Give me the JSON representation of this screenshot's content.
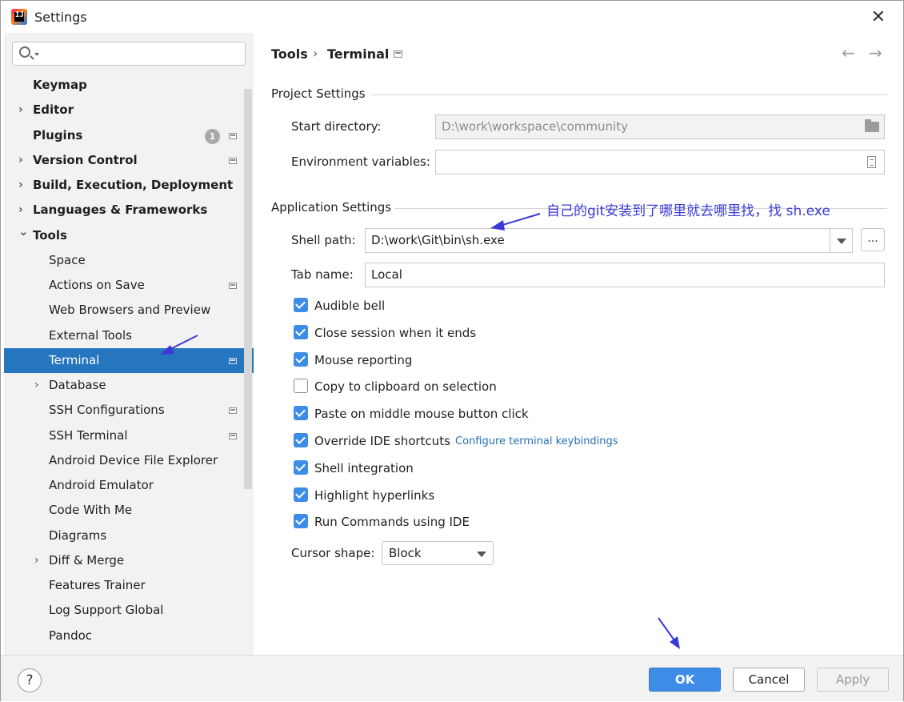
{
  "window": {
    "title": "Settings"
  },
  "sidebar": {
    "search_placeholder": "",
    "items": [
      {
        "label": "Keymap",
        "bold": true,
        "expandable": false,
        "indent": 0
      },
      {
        "label": "Editor",
        "bold": true,
        "expandable": true,
        "indent": 0
      },
      {
        "label": "Plugins",
        "bold": true,
        "expandable": false,
        "indent": 0,
        "badge": "1",
        "project": true
      },
      {
        "label": "Version Control",
        "bold": true,
        "expandable": true,
        "indent": 0,
        "project": true
      },
      {
        "label": "Build, Execution, Deployment",
        "bold": true,
        "expandable": true,
        "indent": 0
      },
      {
        "label": "Languages & Frameworks",
        "bold": true,
        "expandable": true,
        "indent": 0
      },
      {
        "label": "Tools",
        "bold": true,
        "expandable": true,
        "expanded": true,
        "indent": 0
      },
      {
        "label": "Space",
        "indent": 1
      },
      {
        "label": "Actions on Save",
        "indent": 1,
        "project": true
      },
      {
        "label": "Web Browsers and Preview",
        "indent": 1
      },
      {
        "label": "External Tools",
        "indent": 1
      },
      {
        "label": "Terminal",
        "indent": 1,
        "project": true,
        "selected": true
      },
      {
        "label": "Database",
        "indent": 1,
        "expandable": true
      },
      {
        "label": "SSH Configurations",
        "indent": 1,
        "project": true
      },
      {
        "label": "SSH Terminal",
        "indent": 1,
        "project": true
      },
      {
        "label": "Android Device File Explorer",
        "indent": 1
      },
      {
        "label": "Android Emulator",
        "indent": 1
      },
      {
        "label": "Code With Me",
        "indent": 1
      },
      {
        "label": "Diagrams",
        "indent": 1
      },
      {
        "label": "Diff & Merge",
        "indent": 1,
        "expandable": true
      },
      {
        "label": "Features Trainer",
        "indent": 1
      },
      {
        "label": "Log Support Global",
        "indent": 1
      },
      {
        "label": "Pandoc",
        "indent": 1
      }
    ]
  },
  "breadcrumb": {
    "parent": "Tools",
    "separator": "›",
    "current": "Terminal"
  },
  "project_settings": {
    "title": "Project Settings",
    "start_directory_label": "Start directory:",
    "start_directory_value": "D:\\work\\workspace\\community",
    "env_vars_label": "Environment variables:",
    "env_vars_value": ""
  },
  "application_settings": {
    "title": "Application Settings",
    "shell_path_label": "Shell path:",
    "shell_path_value": "D:\\work\\Git\\bin\\sh.exe",
    "browse_label": "...",
    "tab_name_label": "Tab name:",
    "tab_name_value": "Local",
    "checkboxes": [
      {
        "label": "Audible bell",
        "checked": true
      },
      {
        "label": "Close session when it ends",
        "checked": true
      },
      {
        "label": "Mouse reporting",
        "checked": true
      },
      {
        "label": "Copy to clipboard on selection",
        "checked": false
      },
      {
        "label": "Paste on middle mouse button click",
        "checked": true
      },
      {
        "label": "Override IDE shortcuts",
        "checked": true
      },
      {
        "label": "Shell integration",
        "checked": true
      },
      {
        "label": "Highlight hyperlinks",
        "checked": true
      },
      {
        "label": "Run Commands using IDE",
        "checked": true
      }
    ],
    "keybindings_link": "Configure terminal keybindings",
    "cursor_shape_label": "Cursor shape:",
    "cursor_shape_value": "Block"
  },
  "annotation": {
    "text": "自己的git安装到了哪里就去哪里找，找 sh.exe",
    "color": "#3a39d6"
  },
  "buttons": {
    "help": "?",
    "ok": "OK",
    "cancel": "Cancel",
    "apply": "Apply"
  },
  "colors": {
    "accent": "#3d8de6",
    "selected_bg": "#2675bf",
    "link": "#2470b3"
  },
  "icons": {
    "back": "←",
    "forward": "→",
    "close": "✕"
  }
}
